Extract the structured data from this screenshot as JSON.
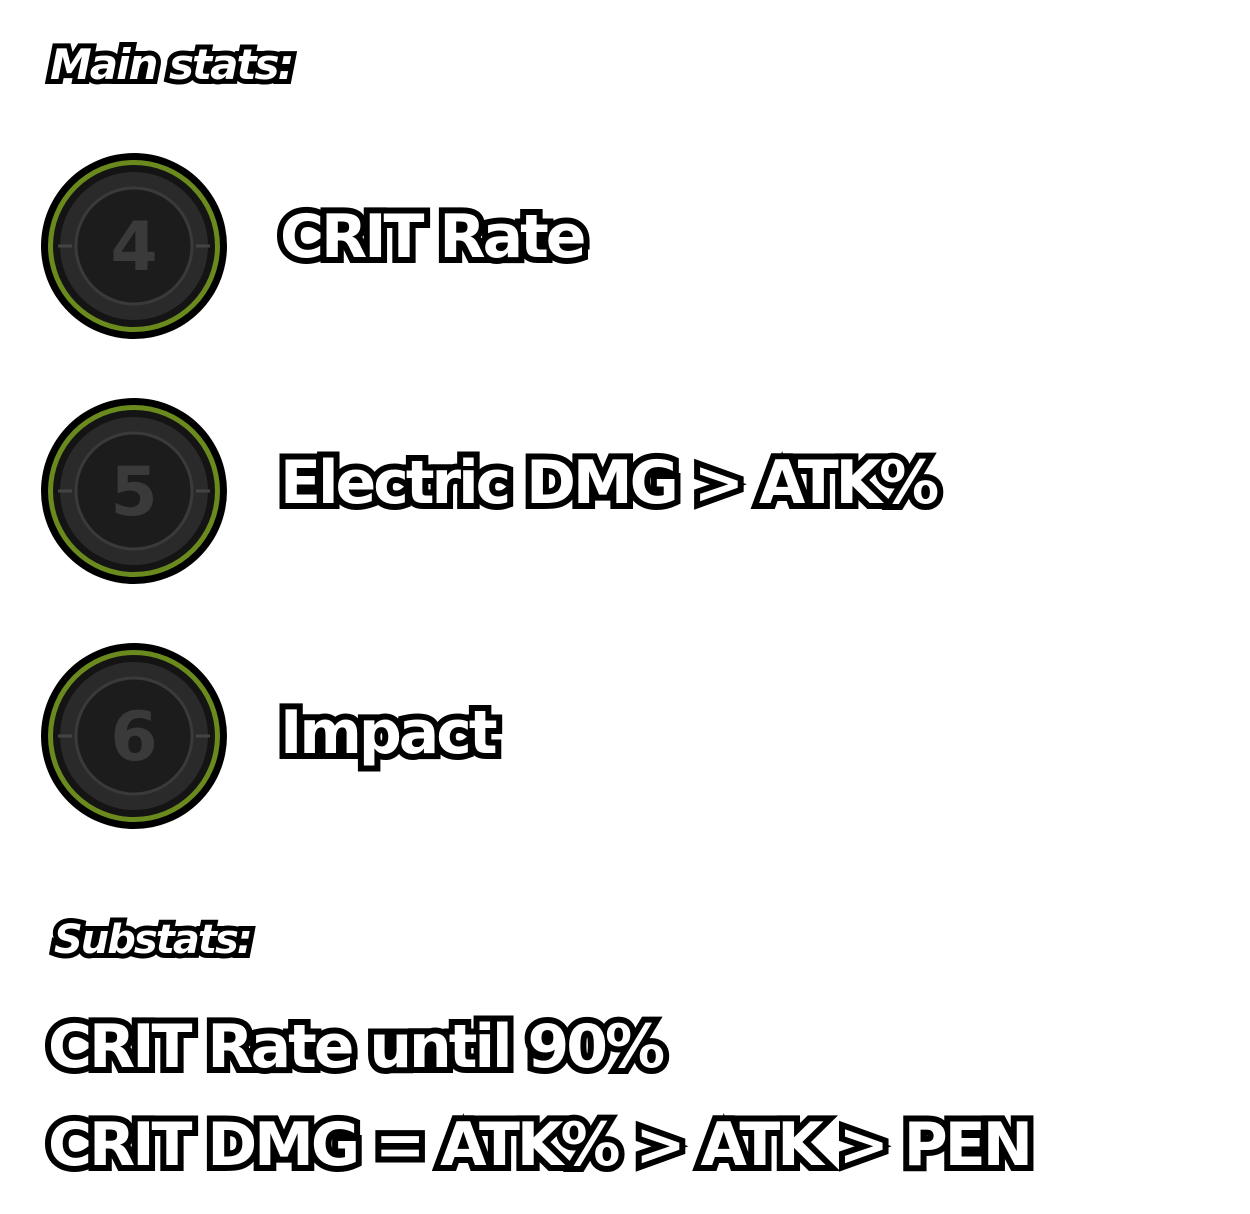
{
  "main_heading": "Main stats:",
  "main_stats": [
    {
      "slot": "4",
      "stat": "CRIT Rate",
      "icon": "disc-slot-4-icon"
    },
    {
      "slot": "5",
      "stat": "Electric DMG > ATK%",
      "icon": "disc-slot-5-icon"
    },
    {
      "slot": "6",
      "stat": "Impact",
      "icon": "disc-slot-6-icon"
    }
  ],
  "sub_heading": "Substats:",
  "substat_lines": [
    "CRIT Rate until 90%",
    "CRIT DMG = ATK% > ATK > PEN"
  ],
  "colors": {
    "text_fill": "#ffffff",
    "text_outline": "#000000",
    "disc_rim_accent": "#6b8a1e",
    "disc_body": "#1c1c1c"
  }
}
